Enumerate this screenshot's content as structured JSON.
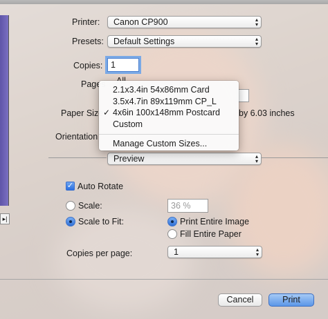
{
  "form": {
    "printer_label": "Printer:",
    "printer_value": "Canon CP900",
    "presets_label": "Presets:",
    "presets_value": "Default Settings",
    "copies_label": "Copies:",
    "copies_value": "1",
    "pages_label": "Pages",
    "pages_all_partial": "All",
    "paper_size_label": "Paper Size",
    "paper_size_suffix": "by 6.03 inches",
    "orientation_label": "Orientation"
  },
  "paper_menu": {
    "items": [
      {
        "label": "2.1x3.4in 54x86mm Card",
        "checked": false
      },
      {
        "label": "3.5x4.7in 89x119mm CP_L",
        "checked": false
      },
      {
        "label": "4x6in 100x148mm Postcard",
        "checked": true
      },
      {
        "label": "Custom",
        "checked": false
      }
    ],
    "check_glyph": "✓",
    "manage_label": "Manage Custom Sizes..."
  },
  "section_popup": "Preview",
  "options": {
    "auto_rotate_label": "Auto Rotate",
    "auto_rotate_checked": true,
    "scale_label": "Scale:",
    "scale_value": "36 %",
    "scale_to_fit_label": "Scale to Fit:",
    "print_entire_image_label": "Print Entire Image",
    "fill_entire_paper_label": "Fill Entire Paper",
    "copies_per_page_label": "Copies per page:",
    "copies_per_page_value": "1"
  },
  "buttons": {
    "cancel": "Cancel",
    "print": "Print"
  },
  "misc": {
    "preview_nav_glyph": "▸|",
    "popup_arrows_glyph": "▴▾"
  },
  "colors": {
    "accent": "#3b78e7",
    "menu_bg": "#fafafa",
    "preview_strip": "#6a5fb5"
  }
}
